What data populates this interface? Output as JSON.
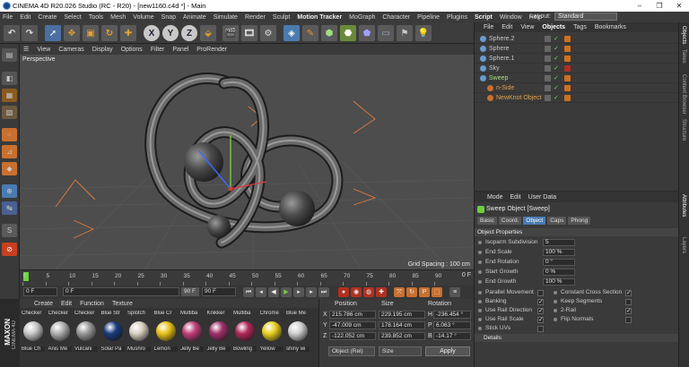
{
  "window": {
    "title": "CINEMA 4D R20.026 Studio (RC - R20) - [new1160.c4d *] - Main"
  },
  "menu": [
    "File",
    "Edit",
    "Create",
    "Select",
    "Tools",
    "Mesh",
    "Volume",
    "Snap",
    "Animate",
    "Simulate",
    "Render",
    "Sculpt",
    "Motion Tracker",
    "MoGraph",
    "Character",
    "Pipeline",
    "Plugins",
    "Script",
    "Window",
    "Help"
  ],
  "layout": {
    "label": "Layout:",
    "value": "Standard"
  },
  "viewport": {
    "menu": [
      "View",
      "Cameras",
      "Display",
      "Options",
      "Filter",
      "Panel",
      "ProRender"
    ],
    "label": "Perspective",
    "grid_spacing": "Grid Spacing : 100 cm"
  },
  "timeline": {
    "ticks": [
      "0",
      "5",
      "10",
      "15",
      "20",
      "25",
      "30",
      "35",
      "40",
      "45",
      "50",
      "55",
      "60",
      "65",
      "70",
      "75",
      "80",
      "85",
      "90"
    ],
    "current_frame_label": "0 F",
    "start": "0 F",
    "start2": "0 F",
    "end": "90 F",
    "end2": "90 F"
  },
  "materials": {
    "menu": [
      "Create",
      "Edit",
      "Function",
      "Texture"
    ],
    "items": [
      {
        "top": "Checker",
        "label": "Blue Ch",
        "color": "#c8c8c8"
      },
      {
        "top": "Checker",
        "label": "Anis Me",
        "color": "#b0b0b0"
      },
      {
        "top": "Checker",
        "label": "Vulcani",
        "color": "#9a9a9a"
      },
      {
        "top": "Blue Str",
        "label": "Solar Pa",
        "color": "#1a3a7a"
      },
      {
        "top": "Splotch",
        "label": "Mushro",
        "color": "#d8d0c0"
      },
      {
        "top": "Blue Cr",
        "label": "Lemon",
        "color": "#e8c21a"
      },
      {
        "top": "Multiba",
        "label": "Jelly Be",
        "color": "#c0407a"
      },
      {
        "top": "Knikker",
        "label": "Jelly Be",
        "color": "#a0306a"
      },
      {
        "top": "Multiba",
        "label": "Bowling",
        "color": "#b0285a"
      },
      {
        "top": "Chrome",
        "label": "Yellow",
        "color": "#e8d020"
      },
      {
        "top": "Blue Me",
        "label": "shiny wi",
        "color": "#d0d0d0"
      }
    ]
  },
  "coordinates": {
    "headers": [
      "Position",
      "Size",
      "Rotation"
    ],
    "rows": [
      {
        "axis": "X",
        "pos": "215.786 cm",
        "size": "229.195 cm",
        "rot_axis": "H",
        "rot": "-236.454 °"
      },
      {
        "axis": "Y",
        "pos": "-47.009 cm",
        "size": "178.164 cm",
        "rot_axis": "P",
        "rot": "6.063 °"
      },
      {
        "axis": "Z",
        "pos": "-122.052 cm",
        "size": "239.852 cm",
        "rot_axis": "B",
        "rot": "-14.17 °"
      }
    ],
    "mode": "Object (Rel)",
    "size_mode": "Size",
    "apply": "Apply"
  },
  "objects": {
    "menu": [
      "File",
      "Edit",
      "View",
      "Objects",
      "Tags",
      "Bookmarks"
    ],
    "items": [
      {
        "name": "Sphere.2",
        "color": "#c8c8c8",
        "indent": 0
      },
      {
        "name": "Sphere",
        "color": "#c8c8c8",
        "indent": 0
      },
      {
        "name": "Sphere.1",
        "color": "#c8c8c8",
        "indent": 0
      },
      {
        "name": "Sky",
        "color": "#c8c8c8",
        "indent": 0
      },
      {
        "name": "Sweep",
        "color": "#9fe07f",
        "indent": 0
      },
      {
        "name": "n-Side",
        "color": "#e0a050",
        "indent": 1
      },
      {
        "name": "NewKnot Object",
        "color": "#e0a050",
        "indent": 1
      }
    ]
  },
  "attributes": {
    "menu": [
      "Mode",
      "Edit",
      "User Data"
    ],
    "title": "Sweep Object [Sweep]",
    "tabs": [
      "Basic",
      "Coord.",
      "Object",
      "Caps",
      "Phong"
    ],
    "selected_tab": "Object",
    "section": "Object Properties",
    "props": [
      {
        "label": "Isoparm Subdivision",
        "value": "5"
      },
      {
        "label": "End Scale",
        "value": "100 %"
      },
      {
        "label": "End Rotation",
        "value": "0 °"
      },
      {
        "label": "Start Growth",
        "value": "0 %"
      },
      {
        "label": "End Growth",
        "value": "100 %"
      }
    ],
    "checks_left": [
      {
        "label": "Parallel Movement",
        "checked": false
      },
      {
        "label": "Banking",
        "checked": true
      },
      {
        "label": "Use Rail Direction",
        "checked": true
      },
      {
        "label": "Use Rail Scale",
        "checked": true
      },
      {
        "label": "Stick UVs",
        "checked": false
      }
    ],
    "checks_right": [
      {
        "label": "Constant Cross Section",
        "checked": true
      },
      {
        "label": "Keep Segments",
        "checked": false
      },
      {
        "label": "2-Rail",
        "checked": true
      },
      {
        "label": "Flip Normals",
        "checked": false
      }
    ],
    "details": "Details"
  },
  "side_tabs": [
    "Objects",
    "Takes",
    "Content Browser",
    "Structure",
    "Attributes",
    "Layers"
  ],
  "brand": {
    "maxon": "MAXON",
    "product": "CINEMA 4D"
  }
}
